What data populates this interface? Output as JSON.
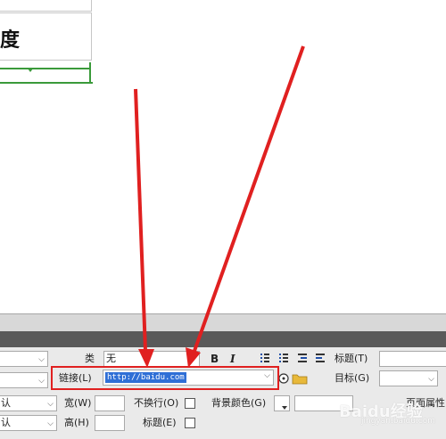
{
  "design": {
    "cell_text": "度"
  },
  "properties": {
    "class_label": "类",
    "class_value": "无",
    "bold": "B",
    "italic": "I",
    "title_label": "标题(T)",
    "link_label": "链接(L)",
    "link_value": "http://baidu.com",
    "target_label": "目标(G)",
    "left_default_1": "认",
    "left_default_2": "认",
    "width_label": "宽(W)",
    "height_label": "高(H)",
    "nowrap_label": "不换行(O)",
    "header_label": "标题(E)",
    "bgcolor_label": "背景颜色(G)",
    "page_props_label": "页面属性"
  },
  "watermark": {
    "text": "Baidu经验",
    "url": "jingyan.baidu.com"
  },
  "annotation_colors": {
    "arrow": "#e02020",
    "frame": "#e02020",
    "selection": "#2f6fd6",
    "table_guide": "#3a9a3a"
  }
}
